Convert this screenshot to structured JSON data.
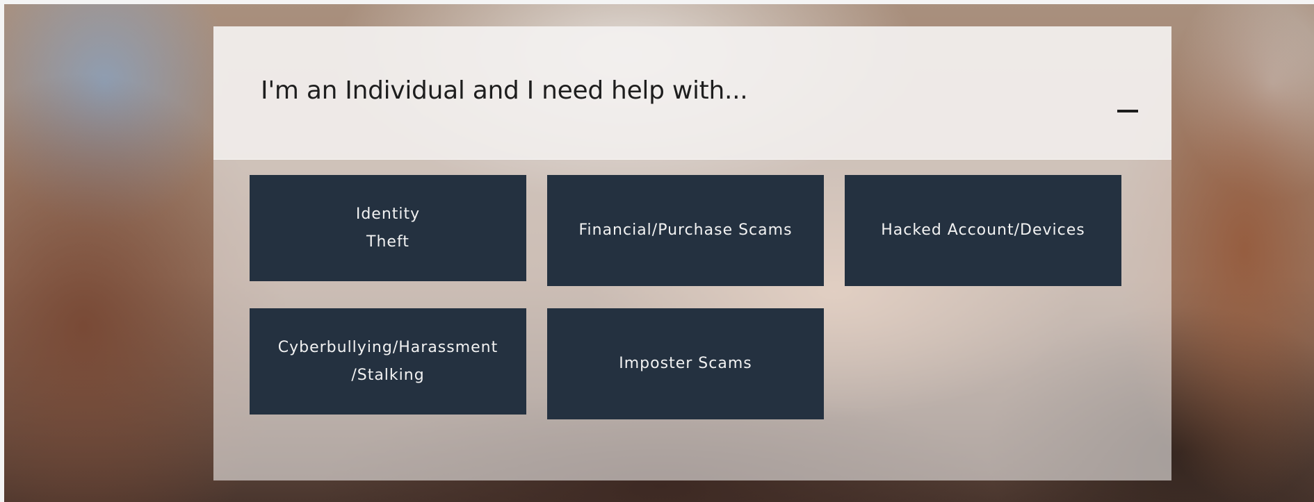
{
  "panel": {
    "title": "I'm an Individual and I need help with...",
    "toggle_icon": "minus-icon"
  },
  "tiles": [
    {
      "line1": "Identity",
      "line2": "Theft"
    },
    {
      "line1": "Financial/Purchase Scams"
    },
    {
      "line1": "Hacked Account/Devices"
    },
    {
      "line1": "Cyberbullying/Harassment",
      "line2": "/Stalking"
    },
    {
      "line1": "Imposter Scams"
    }
  ],
  "colors": {
    "tile_background": "#243140",
    "tile_text": "#f2f2f2",
    "title_text": "#1e1e1e"
  }
}
